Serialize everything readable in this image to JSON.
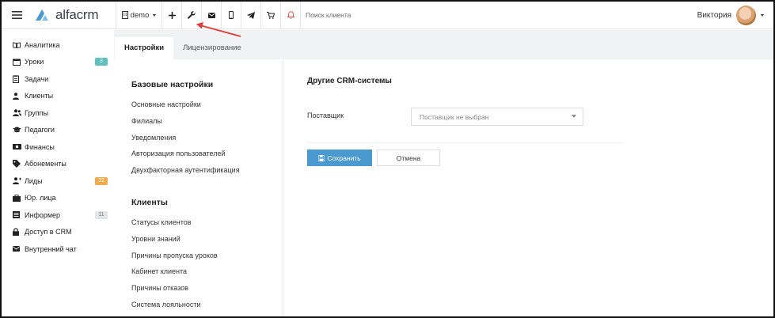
{
  "header": {
    "logo_text": "alfacrm",
    "branch_label": "demo",
    "search_placeholder": "Поиск клиента",
    "user_name": "Виктория"
  },
  "sidebar": {
    "items": [
      {
        "label": "Аналитика",
        "icon": "book-icon"
      },
      {
        "label": "Уроки",
        "icon": "calendar-icon",
        "badge": "3",
        "badge_color": "#5fc2be"
      },
      {
        "label": "Задачи",
        "icon": "clipboard-icon"
      },
      {
        "label": "Клиенты",
        "icon": "user-icon"
      },
      {
        "label": "Группы",
        "icon": "users-icon"
      },
      {
        "label": "Педагоги",
        "icon": "graduation-cap-icon"
      },
      {
        "label": "Финансы",
        "icon": "money-icon"
      },
      {
        "label": "Абонементы",
        "icon": "tag-icon"
      },
      {
        "label": "Лиды",
        "icon": "user-plus-icon",
        "badge": "32",
        "badge_color": "#f0ab4a"
      },
      {
        "label": "Юр. лица",
        "icon": "briefcase-icon"
      },
      {
        "label": "Информер",
        "icon": "newspaper-icon",
        "badge": "11",
        "badge_color": "#e3e6e8"
      },
      {
        "label": "Доступ в CRM",
        "icon": "lock-icon"
      },
      {
        "label": "Внутренний чат",
        "icon": "envelope-icon"
      }
    ]
  },
  "tabs": [
    {
      "label": "Настройки",
      "active": true
    },
    {
      "label": "Лицензирование",
      "active": false
    }
  ],
  "settings_nav": {
    "base_title": "Базовые настройки",
    "base_items": [
      "Основные настройки",
      "Филиалы",
      "Уведомления",
      "Авторизация пользователей",
      "Двухфакторная аутентификация"
    ],
    "clients_title": "Клиенты",
    "clients_items": [
      "Статусы клиентов",
      "Уровни знаний",
      "Причины пропуска уроков",
      "Кабинет клиента",
      "Причины отказов",
      "Система лояльности"
    ]
  },
  "form": {
    "section_title": "Другие CRM-системы",
    "provider_label": "Поставщик",
    "provider_value": "Поставщик не выбран",
    "save_label": "Сохранить",
    "cancel_label": "Отмена"
  },
  "colors": {
    "accent": "#4a9ad0",
    "annotation_arrow": "#e53935",
    "logo_blue": "#4a9ad0"
  }
}
